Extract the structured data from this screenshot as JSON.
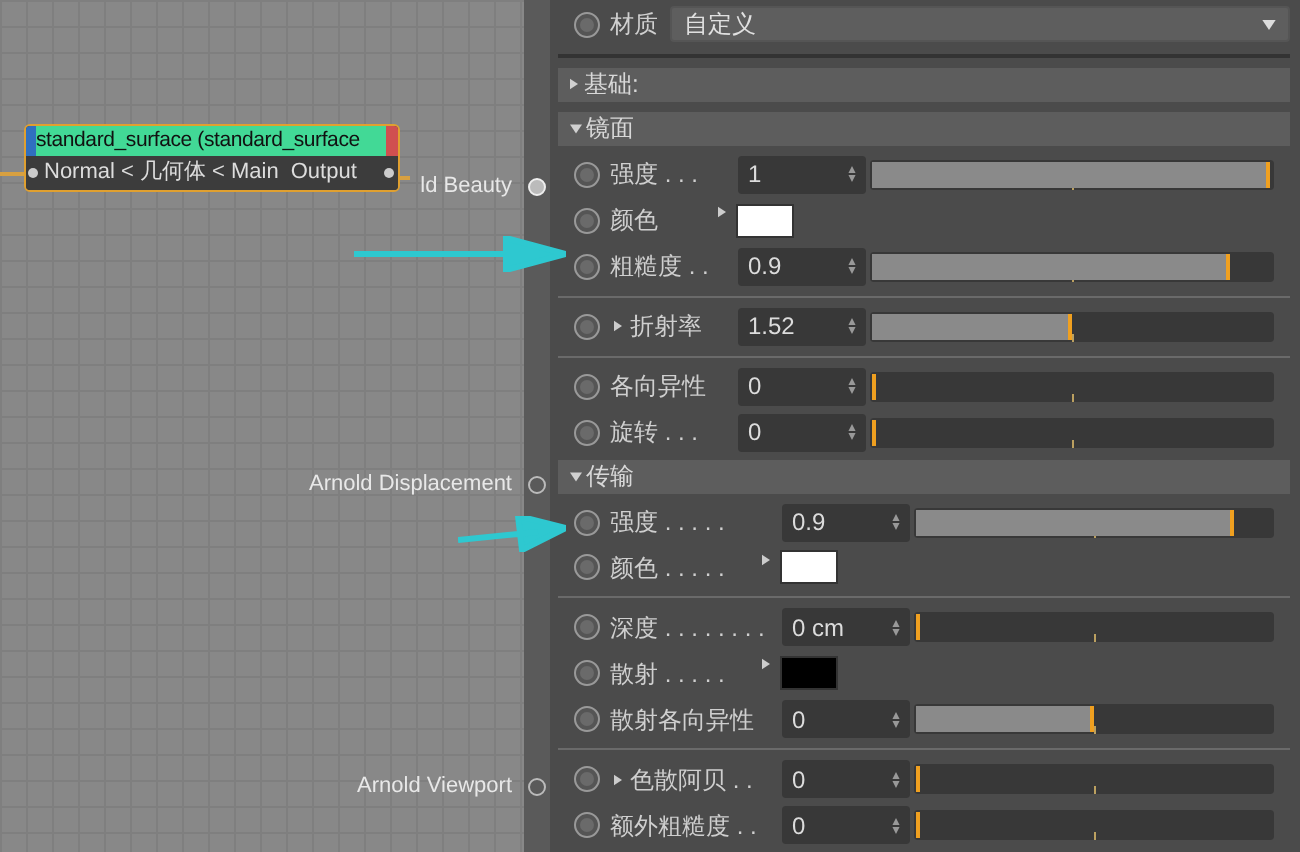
{
  "node_editor": {
    "node": {
      "title": "standard_surface (standard_surface",
      "subtitle": "Normal < 几何体 < Main",
      "output": "Output"
    },
    "ports": [
      {
        "label": "ld Beauty",
        "connected": true
      },
      {
        "label": "Arnold Displacement",
        "connected": false
      },
      {
        "label": "Arnold Viewport",
        "connected": false
      }
    ]
  },
  "material": {
    "label": "材质",
    "value": "自定义"
  },
  "sections": [
    {
      "title": "基础:",
      "expanded": false
    },
    {
      "title": "镜面",
      "expanded": true,
      "rows": [
        {
          "kind": "slider",
          "label": "强度 . . .",
          "value": "1",
          "level": 1.0,
          "expandable": false
        },
        {
          "kind": "color",
          "label": "颜色",
          "color": "#ffffff"
        },
        {
          "kind": "slider",
          "label": "粗糙度 . .",
          "value": "0.9",
          "level": 0.9,
          "expandable": false
        },
        {
          "kind": "divider"
        },
        {
          "kind": "slider",
          "label": "折射率",
          "value": "1.52",
          "level": 0.5,
          "expandable": true
        },
        {
          "kind": "divider"
        },
        {
          "kind": "slider",
          "label": "各向异性",
          "value": "0",
          "level": 0,
          "expandable": false
        },
        {
          "kind": "slider",
          "label": "旋转 . . .",
          "value": "0",
          "level": 0,
          "expandable": false
        }
      ]
    },
    {
      "title": "传输",
      "expanded": true,
      "rows": [
        {
          "kind": "slider",
          "label": "强度 . . . . .",
          "value": "0.9",
          "level": 0.9,
          "expandable": false
        },
        {
          "kind": "color",
          "label": "颜色 . . . . .",
          "color": "#ffffff"
        },
        {
          "kind": "divider"
        },
        {
          "kind": "slider",
          "label": "深度 . . . . . . . .",
          "value": "0 cm",
          "level": 0,
          "expandable": false
        },
        {
          "kind": "color",
          "label": "散射 . . . . .",
          "color": "#000000"
        },
        {
          "kind": "slider",
          "label": "散射各向异性",
          "value": "0",
          "level": 0.5,
          "expandable": false
        },
        {
          "kind": "divider"
        },
        {
          "kind": "slider",
          "label": "色散阿贝 . .",
          "value": "0",
          "level": 0,
          "expandable": true
        },
        {
          "kind": "slider",
          "label": "额外粗糙度 . .",
          "value": "0",
          "level": 0,
          "expandable": false
        }
      ]
    }
  ]
}
